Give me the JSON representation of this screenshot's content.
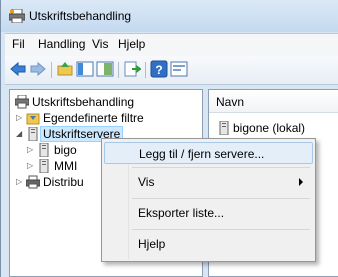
{
  "window": {
    "title": "Utskriftsbehandling"
  },
  "menubar": {
    "items": [
      "Fil",
      "Handling",
      "Vis",
      "Hjelp"
    ]
  },
  "tree": {
    "items": [
      {
        "label": "Utskriftsbehandling"
      },
      {
        "label": "Egendefinerte filtre"
      },
      {
        "label": "Utskriftservere"
      },
      {
        "label": "bigo"
      },
      {
        "label": "MMI"
      },
      {
        "label": "Distribu"
      }
    ]
  },
  "list": {
    "header": "Navn",
    "rows": [
      {
        "label": "bigone (lokal)"
      }
    ]
  },
  "context_menu": {
    "items": [
      {
        "label": "Legg til / fjern servere..."
      },
      {
        "label": "Vis"
      },
      {
        "label": "Eksporter liste..."
      },
      {
        "label": "Hjelp"
      }
    ]
  },
  "icons": {
    "app": "printer-management-icon",
    "back": "back-arrow-icon",
    "forward": "forward-arrow-icon"
  }
}
